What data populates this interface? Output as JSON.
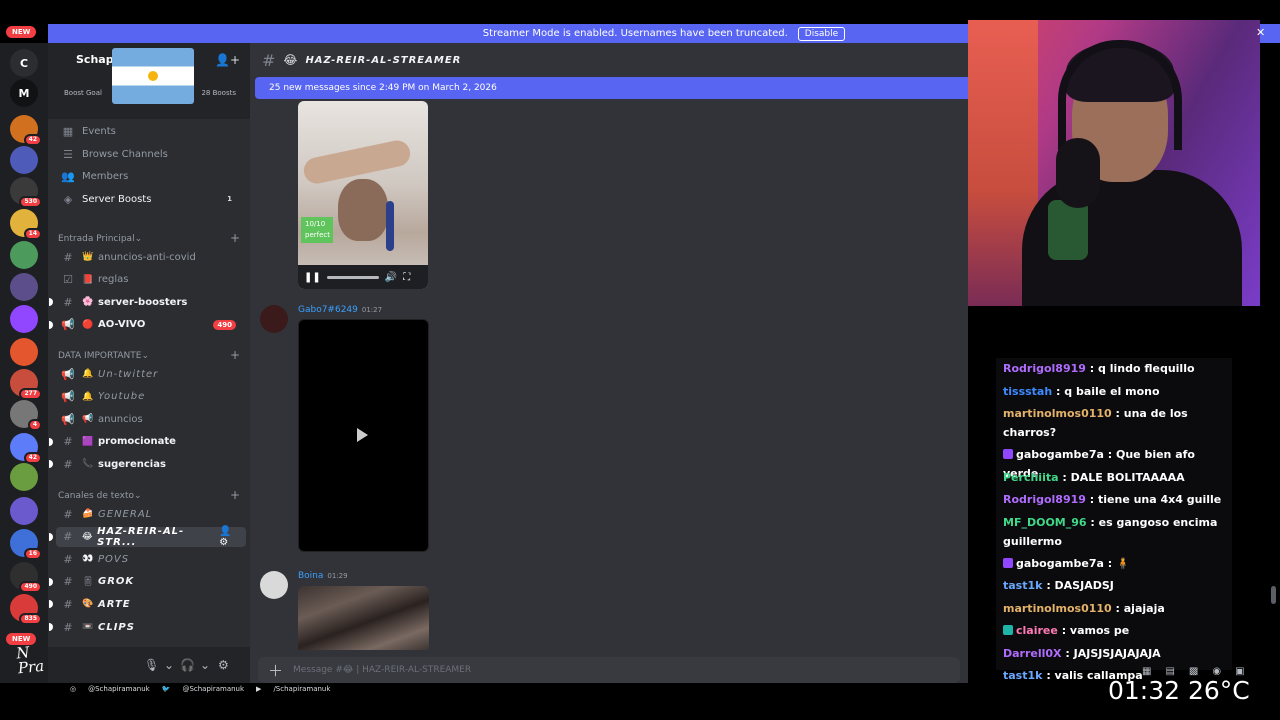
{
  "banner": {
    "new_label": "NEW",
    "text": "Streamer Mode is enabled. Usernames have been truncated.",
    "disable_label": "Disable"
  },
  "rail": {
    "servers": [
      {
        "letter": "C",
        "color": "#2b2d31",
        "badge": ""
      },
      {
        "letter": "M",
        "color": "#111214",
        "badge": ""
      },
      {
        "letter": "",
        "color": "#d1711f",
        "badge": "42"
      },
      {
        "letter": "",
        "color": "#4e5bb8",
        "badge": ""
      },
      {
        "letter": "",
        "color": "#3a3a3a",
        "badge": "530"
      },
      {
        "letter": "",
        "color": "#e2b33c",
        "badge": "14"
      },
      {
        "letter": "",
        "color": "#4d9b5c",
        "badge": ""
      },
      {
        "letter": "",
        "color": "#5b4e8a",
        "badge": ""
      },
      {
        "letter": "",
        "color": "#9146ff",
        "badge": ""
      },
      {
        "letter": "",
        "color": "#e4572e",
        "badge": ""
      },
      {
        "letter": "",
        "color": "#c94d3c",
        "badge": "277"
      },
      {
        "letter": "",
        "color": "#777777",
        "badge": "4"
      },
      {
        "letter": "",
        "color": "#5c7cfa",
        "badge": "42"
      },
      {
        "letter": "",
        "color": "#6a9d3f",
        "badge": ""
      },
      {
        "letter": "",
        "color": "#6a5acd",
        "badge": ""
      },
      {
        "letter": "",
        "color": "#3f6fd8",
        "badge": "16"
      },
      {
        "letter": "",
        "color": "#2f2f2f",
        "badge": "490"
      },
      {
        "letter": "",
        "color": "#d93a3a",
        "badge": "835"
      }
    ],
    "new_label": "NEW"
  },
  "sidebar": {
    "server_name": "Schapi",
    "goal_left": "Boost Goal",
    "goal_right": "28 Boosts",
    "top_items": [
      {
        "icon": "calendar-icon",
        "glyph": "▦",
        "label": "Events",
        "count": ""
      },
      {
        "icon": "browse-icon",
        "glyph": "☰",
        "label": "Browse Channels",
        "count": ""
      },
      {
        "icon": "members-icon",
        "glyph": "👥",
        "label": "Members",
        "count": ""
      },
      {
        "icon": "boost-icon",
        "glyph": "◈",
        "label": "Server Boosts",
        "count": "1"
      }
    ],
    "categories": [
      {
        "name": "Entrada Principal",
        "channels": [
          {
            "glyph": "#",
            "emoji": "👑",
            "label": "anuncios-anti-covid",
            "style": "",
            "count": ""
          },
          {
            "glyph": "☑",
            "emoji": "📕",
            "label": "reglas",
            "style": "",
            "count": ""
          },
          {
            "glyph": "#",
            "emoji": "🌸",
            "label": "server-boosters",
            "style": "bold",
            "count": ""
          },
          {
            "glyph": "📢",
            "emoji": "🔴",
            "label": "AO-VIVO",
            "style": "bold",
            "count": "490"
          }
        ]
      },
      {
        "name": "DATA IMPORTANTE",
        "channels": [
          {
            "glyph": "📢",
            "emoji": "🔔",
            "label": "Un-twitter",
            "style": "italic",
            "count": ""
          },
          {
            "glyph": "📢",
            "emoji": "🔔",
            "label": "Youtube",
            "style": "italic",
            "count": ""
          },
          {
            "glyph": "📢",
            "emoji": "📢",
            "label": "anuncios",
            "style": "",
            "count": ""
          },
          {
            "glyph": "#",
            "emoji": "🟪",
            "label": "promocionate",
            "style": "bold",
            "count": ""
          },
          {
            "glyph": "#",
            "emoji": "📞",
            "label": "sugerencias",
            "style": "bold",
            "count": ""
          }
        ]
      },
      {
        "name": "Canales de texto",
        "channels": [
          {
            "glyph": "#",
            "emoji": "🍰",
            "label": "GENERAL",
            "style": "italic",
            "count": ""
          },
          {
            "glyph": "#",
            "emoji": "😂",
            "label": "HAZ-REIR-AL-STR...",
            "style": "bold italic",
            "count": "",
            "active": true
          },
          {
            "glyph": "#",
            "emoji": "👀",
            "label": "POVS",
            "style": "italic",
            "count": ""
          },
          {
            "glyph": "#",
            "emoji": "🎚",
            "label": "GROK",
            "style": "bold italic",
            "count": ""
          },
          {
            "glyph": "#",
            "emoji": "🎨",
            "label": "ARTE",
            "style": "bold italic",
            "count": ""
          },
          {
            "glyph": "#",
            "emoji": "📼",
            "label": "CLIPS",
            "style": "bold italic",
            "count": ""
          }
        ]
      }
    ]
  },
  "main": {
    "channel_title": "HAZ-REIR-AL-STREAMER",
    "channel_emoji": "😂",
    "new_messages": "25 new messages since 2:49 PM on March 2, 2026",
    "video1_rating_line1": "10/10",
    "video1_rating_line2": "perfect",
    "messages": [
      {
        "user": "Gabo7#6249",
        "time": "01:27",
        "color": "#3ba0ff"
      },
      {
        "user": "Boina",
        "time": "01:29",
        "color": "#3ba0ff"
      }
    ],
    "composer_placeholder": "Message #😂 | HAZ-REIR-AL-STREAMER"
  },
  "social": {
    "instagram": "@Schapiramanuk",
    "twitter": "@Schapiramanuk",
    "youtube": "/Schapiramanuk"
  },
  "chat": [
    {
      "user": "Rodrigol8919",
      "color": "#b06cff",
      "text": ": q lindo flequillo",
      "badge": ""
    },
    {
      "user": "tissstah",
      "color": "#3d8bff",
      "text": ": q baile el mono",
      "badge": ""
    },
    {
      "user": "martinolmos0110",
      "color": "#e4b26a",
      "text": ": una de los charros?",
      "badge": ""
    },
    {
      "user": "gabogambe7a",
      "color": "#ffffff",
      "text": ": Que bien afo verde",
      "badge": "sub"
    },
    {
      "user": "Perchiita",
      "color": "#40d98a",
      "text": ": DALE BOLITAAAAA",
      "badge": ""
    },
    {
      "user": "Rodrigol8919",
      "color": "#b06cff",
      "text": ": tiene una 4x4 guille",
      "badge": ""
    },
    {
      "user": "MF_DOOM_96",
      "color": "#40d98a",
      "text": ": es gangoso encima guillermo",
      "badge": ""
    },
    {
      "user": "gabogambe7a",
      "color": "#ffffff",
      "text": ": 🧍",
      "badge": "sub"
    },
    {
      "user": "tast1k",
      "color": "#6aa8ff",
      "text": ": DASJADSJ",
      "badge": ""
    },
    {
      "user": "martinolmos0110",
      "color": "#e4b26a",
      "text": ": ajajaja",
      "badge": ""
    },
    {
      "user": "clairee",
      "color": "#ff7ab6",
      "text": ": vamos pe",
      "badge": "alt"
    },
    {
      "user": "Darrell0X",
      "color": "#b06cff",
      "text": ": JAJSJSJAJAJAJA",
      "badge": ""
    },
    {
      "user": "tast1k",
      "color": "#6aa8ff",
      "text": ": valis callampa",
      "badge": ""
    }
  ],
  "hud": {
    "time": "01:32",
    "temp": "26°C"
  },
  "logo_text": "Schapi"
}
